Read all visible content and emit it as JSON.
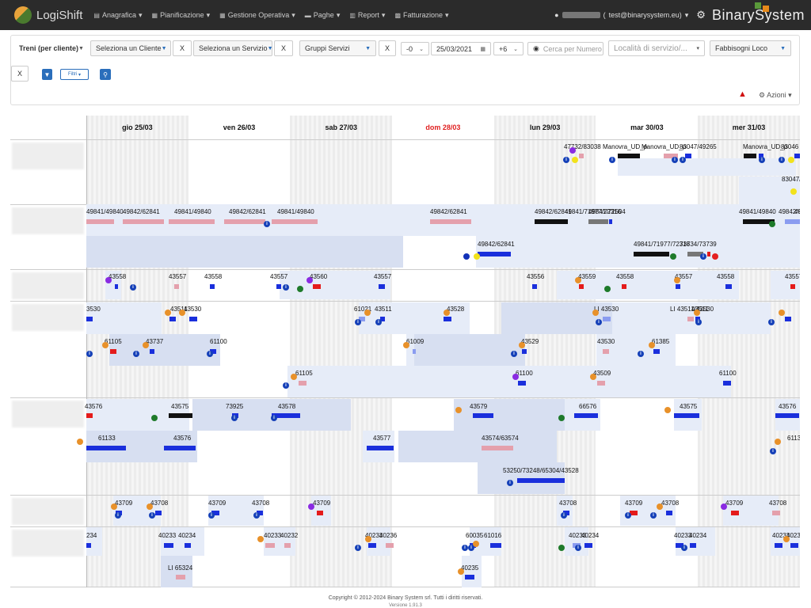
{
  "nav": {
    "app_name": "LogiShift",
    "menus": [
      {
        "label": "Anagrafica",
        "icon": "list-icon"
      },
      {
        "label": "Pianificazione",
        "icon": "calendar-icon"
      },
      {
        "label": "Gestione Operativa",
        "icon": "calendar-icon"
      },
      {
        "label": "Paghe",
        "icon": "money-icon"
      },
      {
        "label": "Report",
        "icon": "file-icon"
      },
      {
        "label": "Fatturazione",
        "icon": "bank-icon"
      }
    ],
    "user_email": "test@binarysystem.eu)",
    "brand": "BinarySystem"
  },
  "filters": {
    "mode": "Treni (per cliente)",
    "client": "Seleziona un Cliente",
    "service": "Seleziona un Servizio",
    "groups": "Gruppi Servizi",
    "x": "X",
    "offset_before": "-0",
    "date": "25/03/2021",
    "offset_after": "+6",
    "search_placeholder": "Cerca per Numero",
    "location_placeholder": "Località di servizio/...",
    "needs": "Fabbisogni Loco",
    "filters_btn": "Filtri",
    "actions": "Azioni"
  },
  "days": [
    {
      "label": "gio 25/03",
      "holiday": false
    },
    {
      "label": "ven 26/03",
      "holiday": false
    },
    {
      "label": "sab 27/03",
      "holiday": false
    },
    {
      "label": "dom 28/03",
      "holiday": true
    },
    {
      "label": "lun 29/03",
      "holiday": false
    },
    {
      "label": "mar 30/03",
      "holiday": false
    },
    {
      "label": "mer 31/03",
      "holiday": false
    }
  ],
  "colors": {
    "holiday": "#e02020",
    "nav_bg": "#2b2b2b",
    "accent": "#2a6ebb"
  },
  "trains": {
    "r1": [
      "47732/83038",
      "Manovra_UD_p",
      "Manovra_UD_p",
      "83047/49265",
      "Manovra_UD_p",
      "83046",
      "83047/"
    ],
    "r2": [
      "49841/49840",
      "49842/62841",
      "49841/49840",
      "49842/62841",
      "49841/49840",
      "49842/62841",
      "49842/62841",
      "49841/71977/72316",
      "49841/72504",
      "49841/49840",
      "49842/62841",
      "49841/71977/72316",
      "73734/73739",
      "49842/62841",
      "49841/49"
    ],
    "r3": [
      "43558",
      "43557",
      "43558",
      "43557",
      "43560",
      "43557",
      "43556",
      "43559",
      "43558",
      "43557",
      "43558",
      "43557"
    ],
    "r4": [
      "3530",
      "43511",
      "43530",
      "61021",
      "43511",
      "43528",
      "LI 43530",
      "LI 43511/43530",
      "43511",
      "61105",
      "43737",
      "61100",
      "61009",
      "43529",
      "43530",
      "61385",
      "61105",
      "61100",
      "43509",
      "61100"
    ],
    "r5": [
      "43576",
      "43575",
      "73925",
      "43578",
      "43579",
      "66576",
      "43575",
      "43576",
      "61133",
      "43576",
      "43577",
      "43574/63574",
      "53250/73248/65304/43528",
      "6113"
    ],
    "r6": [
      "43709",
      "43708",
      "43709",
      "43708",
      "43709",
      "43708",
      "43709",
      "43708",
      "43709",
      "43708"
    ],
    "r7": [
      "234",
      "40233",
      "40234",
      "40233",
      "40232",
      "40233",
      "40236",
      "60035",
      "61016",
      "40233",
      "40234",
      "40233",
      "40234",
      "40233",
      "40234",
      "LI 65324",
      "40235"
    ]
  },
  "footer": {
    "copyright": "Copyright © 2012-2024 Binary System srl. Tutti i diritti riservati.",
    "version": "Versione 1.91.3"
  }
}
